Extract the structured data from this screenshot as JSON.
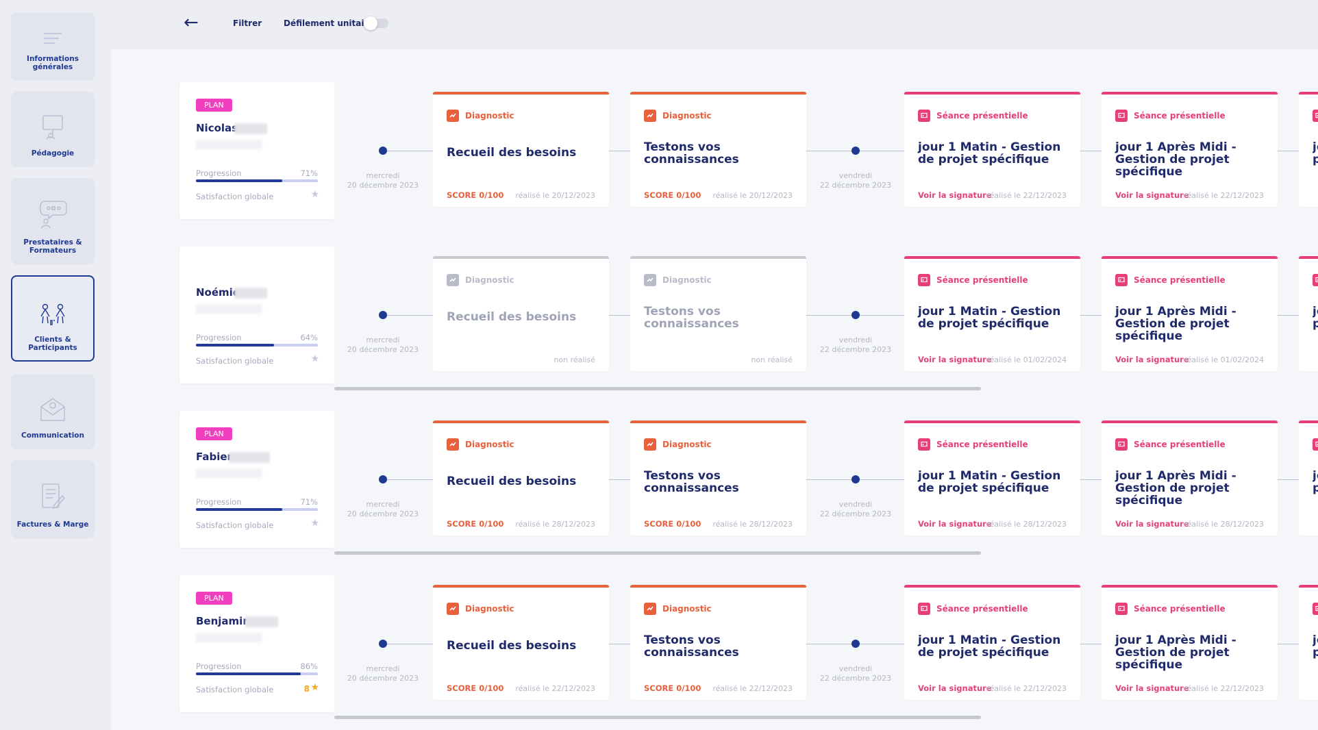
{
  "sidebar": {
    "items": [
      {
        "label": "Informations\ngénérales",
        "icon": "list-icon"
      },
      {
        "label": "Pédagogie",
        "icon": "presentation-icon"
      },
      {
        "label": "Prestataires &\nFormateurs",
        "icon": "trainer-icon"
      },
      {
        "label": "Clients &\nParticipants",
        "icon": "participants-icon",
        "active": true
      },
      {
        "label": "Communication",
        "icon": "mail-icon"
      },
      {
        "label": "Factures & Marge",
        "icon": "invoice-icon"
      }
    ]
  },
  "topbar": {
    "back_icon": "←",
    "filter_label": "Filtrer",
    "unit_scroll_label": "Défilement unitaire",
    "unit_scroll_on": false
  },
  "colors": {
    "diagnostic": "#e8603c",
    "session": "#e83e79",
    "muted": "#b8bcc8",
    "plan_badge": "#f03fbf",
    "primary": "#1f3a93",
    "star": "#f5a623"
  },
  "labels": {
    "plan_badge": "PLAN",
    "progression": "Progression",
    "satisfaction": "Satisfaction globale",
    "diagnostic": "Diagnostic",
    "session": "Séance présentielle",
    "signature": "Voir la signature",
    "date1": "mercredi\n20 décembre 2023",
    "date2": "vendredi\n22 décembre 2023",
    "card1_title": "Recueil des besoins",
    "card2_title": "Testons vos connaissances",
    "card3_title": "jour 1 Matin - Gestion de projet spécifique",
    "card4_title": "jour 1 Après Midi - Gestion de projet spécifique",
    "card5_title": "jo p"
  },
  "participants": [
    {
      "name": "Nicolas",
      "plan": true,
      "progress_pct": 71,
      "progress_label": "71%",
      "satisfaction": "",
      "cards": [
        {
          "done": true,
          "footer_left": "SCORE 0/100",
          "footer_right": "réalisé le 20/12/2023"
        },
        {
          "done": true,
          "footer_left": "SCORE 0/100",
          "footer_right": "réalisé le 20/12/2023"
        },
        {
          "footer_left": "Voir la signature",
          "footer_right": "réalisé le 22/12/2023"
        },
        {
          "footer_left": "Voir la signature",
          "footer_right": "réalisé le 22/12/2023"
        }
      ]
    },
    {
      "name": "Noémie",
      "plan": false,
      "progress_pct": 64,
      "progress_label": "64%",
      "satisfaction": "",
      "cards": [
        {
          "done": false,
          "footer_left": "",
          "footer_right": "non réalisé"
        },
        {
          "done": false,
          "footer_left": "",
          "footer_right": "non réalisé"
        },
        {
          "footer_left": "Voir la signature",
          "footer_right": "réalisé le 01/02/2024"
        },
        {
          "footer_left": "Voir la signature",
          "footer_right": "réalisé le 01/02/2024"
        }
      ]
    },
    {
      "name": "Fabien",
      "plan": true,
      "progress_pct": 71,
      "progress_label": "71%",
      "satisfaction": "",
      "cards": [
        {
          "done": true,
          "footer_left": "SCORE 0/100",
          "footer_right": "réalisé le 28/12/2023"
        },
        {
          "done": true,
          "footer_left": "SCORE 0/100",
          "footer_right": "réalisé le 28/12/2023"
        },
        {
          "footer_left": "Voir la signature",
          "footer_right": "réalisé le 28/12/2023"
        },
        {
          "footer_left": "Voir la signature",
          "footer_right": "réalisé le 28/12/2023"
        }
      ]
    },
    {
      "name": "Benjamin",
      "plan": true,
      "progress_pct": 86,
      "progress_label": "86%",
      "satisfaction": "8",
      "cards": [
        {
          "done": true,
          "footer_left": "SCORE 0/100",
          "footer_right": "réalisé le 22/12/2023"
        },
        {
          "done": true,
          "footer_left": "SCORE 0/100",
          "footer_right": "réalisé le 22/12/2023"
        },
        {
          "footer_left": "Voir la signature",
          "footer_right": "réalisé le 22/12/2023"
        },
        {
          "footer_left": "Voir la signature",
          "footer_right": "réalisé le 22/12/2023"
        }
      ]
    }
  ]
}
